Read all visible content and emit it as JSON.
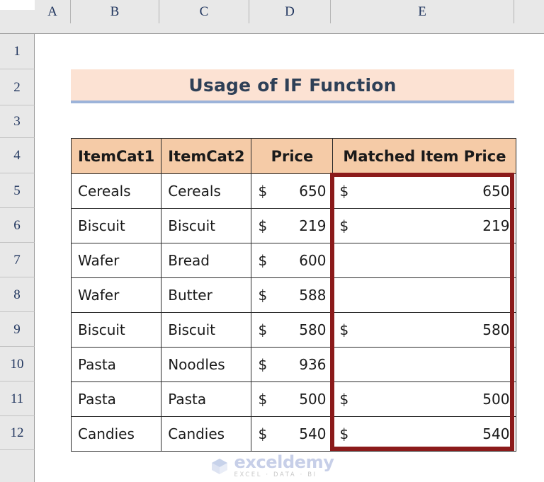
{
  "app": {
    "type": "spreadsheet"
  },
  "grid": {
    "column_headers": [
      "A",
      "B",
      "C",
      "D",
      "E"
    ],
    "row_headers": [
      "1",
      "2",
      "3",
      "4",
      "5",
      "6",
      "7",
      "8",
      "9",
      "10",
      "11",
      "12"
    ],
    "select_all_icon": "select-all-triangle-icon"
  },
  "title": {
    "text": "Usage of IF Function",
    "background_color": "#FCE2D3",
    "text_color": "#2E4057",
    "underline_color": "#9CB3D9"
  },
  "table": {
    "header_background": "#F5CBA7",
    "headers": [
      "ItemCat1",
      "ItemCat2",
      "Price",
      "Matched Item Price"
    ],
    "currency_symbol": "$",
    "highlight_border_color": "#8B1A1A",
    "rows": [
      {
        "item_cat1": "Cereals",
        "item_cat2": "Cereals",
        "price": "650",
        "matched_price": "650"
      },
      {
        "item_cat1": "Biscuit",
        "item_cat2": "Biscuit",
        "price": "219",
        "matched_price": "219"
      },
      {
        "item_cat1": "Wafer",
        "item_cat2": "Bread",
        "price": "600",
        "matched_price": ""
      },
      {
        "item_cat1": "Wafer",
        "item_cat2": "Butter",
        "price": "588",
        "matched_price": ""
      },
      {
        "item_cat1": "Biscuit",
        "item_cat2": "Biscuit",
        "price": "580",
        "matched_price": "580"
      },
      {
        "item_cat1": "Pasta",
        "item_cat2": "Noodles",
        "price": "936",
        "matched_price": ""
      },
      {
        "item_cat1": "Pasta",
        "item_cat2": "Pasta",
        "price": "500",
        "matched_price": "500"
      },
      {
        "item_cat1": "Candies",
        "item_cat2": "Candies",
        "price": "540",
        "matched_price": "540"
      }
    ]
  },
  "watermark": {
    "name": "exceldemy",
    "tagline": "EXCEL · DATA · BI"
  }
}
